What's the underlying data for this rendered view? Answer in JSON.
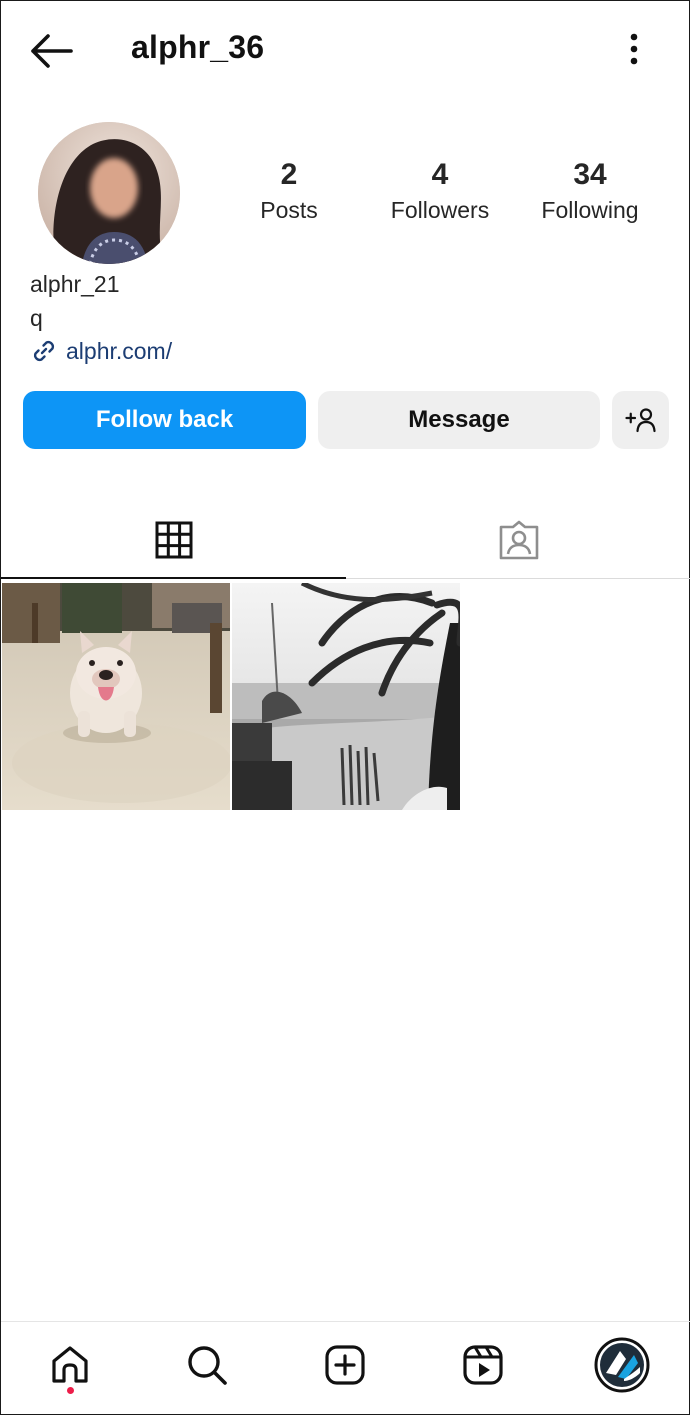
{
  "header": {
    "username": "alphr_36",
    "back_icon": "arrow-left-icon",
    "more_icon": "more-vertical-icon"
  },
  "profile": {
    "display_name": "alphr_21",
    "bio": "q",
    "link": "alphr.com/",
    "link_icon": "link-icon",
    "stats": {
      "posts": {
        "count": "2",
        "label": "Posts"
      },
      "followers": {
        "count": "4",
        "label": "Followers"
      },
      "following": {
        "count": "34",
        "label": "Following"
      }
    }
  },
  "actions": {
    "follow_back_label": "Follow back",
    "message_label": "Message",
    "suggest_icon": "add-person-icon"
  },
  "tabs": [
    {
      "name": "grid",
      "icon": "grid-icon",
      "active": true
    },
    {
      "name": "tagged",
      "icon": "tagged-person-icon",
      "active": false
    }
  ],
  "posts": [
    {
      "subject": "bulldog on sand"
    },
    {
      "subject": "beach with palm tree, black and white"
    }
  ],
  "bottom_nav": [
    {
      "icon": "home-icon",
      "active": true,
      "notification_dot": true
    },
    {
      "icon": "search-icon",
      "active": false
    },
    {
      "icon": "create-post-icon",
      "active": false
    },
    {
      "icon": "reels-icon",
      "active": false
    },
    {
      "icon": "profile-avatar-icon",
      "active": false
    }
  ],
  "colors": {
    "primary_button": "#0d95f6",
    "secondary_button": "#efefef",
    "link": "#1c3d73",
    "notification_dot": "#ed1d49",
    "text": "#262626"
  }
}
